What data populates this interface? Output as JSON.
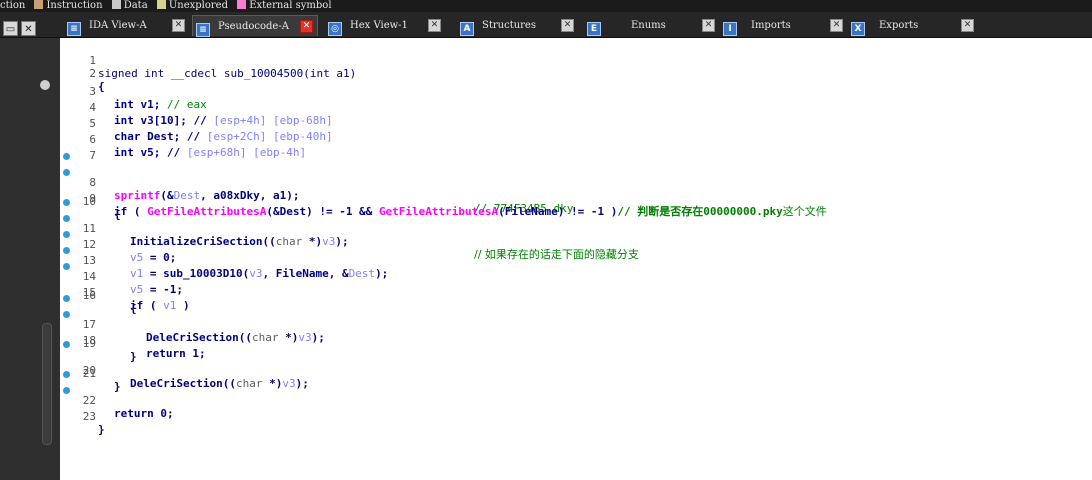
{
  "legend": [
    {
      "label": "ction",
      "color": "#ff8c28"
    },
    {
      "label": "Instruction",
      "color": "#c8a078"
    },
    {
      "label": "Data",
      "color": "#c8c8c8"
    },
    {
      "label": "Unexplored",
      "color": "#d4d48c"
    },
    {
      "label": "External symbol",
      "color": "#ff7ad4"
    }
  ],
  "tabs": [
    {
      "label": "IDA View-A",
      "icon": "listing-icon"
    },
    {
      "label": "Pseudocode-A",
      "icon": "pseudocode-icon",
      "active": true
    },
    {
      "label": "Hex View-1",
      "icon": "hex-icon"
    },
    {
      "label": "Structures",
      "icon": "struct-icon"
    },
    {
      "label": "Enums",
      "icon": "enum-icon"
    },
    {
      "label": "Imports",
      "icon": "imports-icon"
    },
    {
      "label": "Exports",
      "icon": "exports-icon"
    }
  ],
  "code": {
    "l1": {
      "n": "1",
      "a": "signed int __cdecl sub_10004500(int a1)"
    },
    "l2": {
      "n": "2",
      "a": "{"
    },
    "l3": {
      "n": "3",
      "a": "int v1; ",
      "b": "// eax"
    },
    "l4": {
      "n": "4",
      "a": "int v3[10]; ",
      "b": "// ",
      "c": "[esp+4h] [ebp-68h]"
    },
    "l5": {
      "n": "5",
      "a": "char Dest; ",
      "b": "// ",
      "c": "[esp+2Ch] [ebp-40h]"
    },
    "l6": {
      "n": "6",
      "a": "int v5; ",
      "b": "// ",
      "c": "[esp+68h] [ebp-4h]"
    },
    "l7": {
      "n": "7"
    },
    "l8": {
      "n": "8",
      "a": "sprintf",
      "b": "(&",
      "c": "Dest",
      "d": ", a08xDky, a1);",
      "e": "// 774F34B5.dky"
    },
    "l9": {
      "n": "9",
      "a": "if ( ",
      "b": "GetFileAttributesA",
      "c": "(&Dest) != -1 && ",
      "d": "GetFileAttributesA",
      "e": "(FileName) != -1 )",
      "f": "// 判断是否存在",
      "g": "00000000.pky",
      "h": "这个文件"
    },
    "l10": {
      "n": "10",
      "a": "{"
    },
    "l11": {
      "n": "11",
      "a": "InitializeCriSection((",
      "b": "char",
      "c": " *)",
      "d": "v3",
      "e": ");",
      "f": "// 如果存在的话走下面的隐藏分支"
    },
    "l12": {
      "n": "12",
      "a": "v5",
      "b": " = 0;"
    },
    "l13": {
      "n": "13",
      "a": "v1",
      "b": " = sub_10003D10(",
      "c": "v3",
      "d": ", FileName, &",
      "e": "Dest",
      "f": ");"
    },
    "l14": {
      "n": "14",
      "a": "v5",
      "b": " = -1;"
    },
    "l15": {
      "n": "15",
      "a": "if ( ",
      "b": "v1",
      "c": " )"
    },
    "l16": {
      "n": "16",
      "a": "{"
    },
    "l17": {
      "n": "17",
      "a": "DeleCriSection((",
      "b": "char",
      "c": " *)",
      "d": "v3",
      "e": ");"
    },
    "l18": {
      "n": "18",
      "a": "return 1;"
    },
    "l19": {
      "n": "19",
      "a": "}"
    },
    "l20": {
      "n": "20",
      "a": "DeleCriSection((",
      "b": "char",
      "c": " *)",
      "d": "v3",
      "e": ");"
    },
    "l21": {
      "n": "21",
      "a": "}"
    },
    "l22": {
      "n": "22",
      "a": "return 0;"
    },
    "l23": {
      "n": "23",
      "a": "}"
    }
  }
}
